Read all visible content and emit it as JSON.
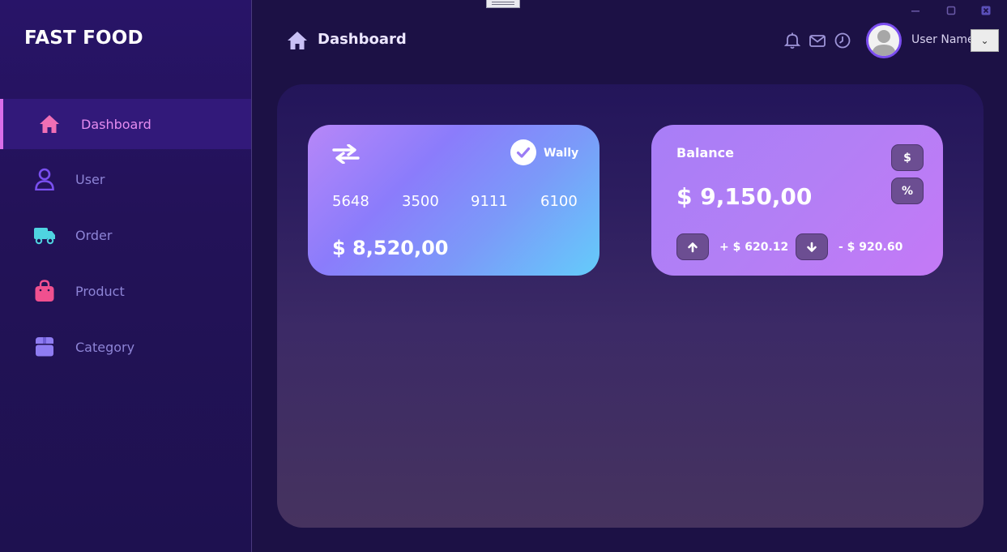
{
  "app": {
    "brand": "FAST FOOD"
  },
  "sidebar": {
    "items": [
      {
        "label": "Dashboard",
        "icon": "home-icon",
        "active": true,
        "color": "#f06fb5"
      },
      {
        "label": "User",
        "icon": "user-icon",
        "active": false,
        "color": "#7a4ff0"
      },
      {
        "label": "Order",
        "icon": "truck-icon",
        "active": false,
        "color": "#4fd3e0"
      },
      {
        "label": "Product",
        "icon": "shopping-bag-icon",
        "active": false,
        "color": "#f0508f"
      },
      {
        "label": "Category",
        "icon": "box-icon",
        "active": false,
        "color": "#8f7cf2"
      }
    ]
  },
  "header": {
    "title": "Dashboard",
    "icons": [
      "bell-icon",
      "mail-icon",
      "clock-icon"
    ],
    "user_name": "User Name",
    "dropdown_glyph": "⌄"
  },
  "card": {
    "owner": "Wally",
    "numbers": [
      "5648",
      "3500",
      "9111",
      "6100"
    ],
    "amount": "$ 8,520,00"
  },
  "balance": {
    "label": "Balance",
    "amount": "$ 9,150,00",
    "dollar_button": "$",
    "percent_button": "%",
    "income": "+ $ 620.12",
    "expense": "- $ 920.60"
  },
  "colors": {
    "accent": "#d96ee8",
    "sidebar_bg": "#231258",
    "panel_bg": "#2c1d5f"
  }
}
